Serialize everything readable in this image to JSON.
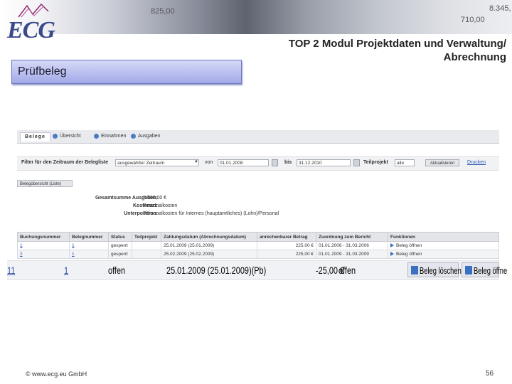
{
  "header": {
    "logo": "ECG",
    "banner_numbers": [
      "825,00",
      "710,00",
      "8.345,"
    ],
    "slide_title": "TOP 2 Modul Projektdaten und Verwaltung/ Abrechnung"
  },
  "section_label": "Prüfbeleg",
  "app": {
    "tabs": [
      {
        "label": "Belege",
        "active": true
      },
      {
        "label": "Übersicht",
        "active": false
      },
      {
        "label": "Einnahmen",
        "active": false
      },
      {
        "label": "Ausgaben",
        "active": false
      }
    ],
    "filter": {
      "label": "Filter für den Zeitraum der Belegliste",
      "period_value": "ausgewählter Zeitraum",
      "from_label": "von",
      "from_value": "01.01.2008",
      "to_label": "bis",
      "to_value": "31.12.2010",
      "subproject_label": "Teilprojekt",
      "subproject_value": "alle",
      "refresh_label": "Aktualisieren",
      "print_label": "Drucken"
    },
    "back_button": "Belegübersicht (Liste)",
    "summary": {
      "total_label": "Gesamtsumme Ausgaben:",
      "total_value": "7.500,00 €",
      "cost_type_label": "Kostenart:",
      "cost_type_value": "Personalkosten",
      "subposition_label": "Unterposition:",
      "subposition_value": "Personalkosten für Internes (hauptamtliches) (Lohn)/Personal"
    },
    "table": {
      "headers": [
        "Buchungsnummer",
        "Belegnummer",
        "Status",
        "Teilprojekt",
        "Zahlungsdatum (Abrechnungsdatum)",
        "anrechenbarer Betrag",
        "Zuordnung zum Bericht",
        "Funktionen"
      ],
      "rows": [
        {
          "booking": "1",
          "receipt": "1",
          "status": "gesperrt",
          "subproject": "",
          "date": "25.01.2009 (25.01.2009)",
          "amount": "225,00 €",
          "report": "01.01.2006 - 31.03.2006",
          "action": "Beleg öffnen"
        },
        {
          "booking": "2",
          "receipt": "1",
          "status": "gesperrt",
          "subproject": "",
          "date": "25.02.2009 (25.02.2009)",
          "amount": "225,00 €",
          "report": "01.01.2009 - 31.03.2009",
          "action": "Beleg öffnen"
        }
      ]
    }
  },
  "zoom_row": {
    "booking": "11",
    "receipt": "1",
    "status": "offen",
    "date": "25.01.2009 (25.01.2009)(Pb)",
    "amount": "-25,00 €",
    "report": "offen",
    "delete_label": "Beleg löschen",
    "open_label": "Beleg öffne"
  },
  "footer": {
    "copyright": "© www.ecg.eu GmbH",
    "page": "56"
  },
  "colors": {
    "accent": "#3b4a8a",
    "label_fill": "#b7bdef",
    "link": "#2b59b3"
  }
}
